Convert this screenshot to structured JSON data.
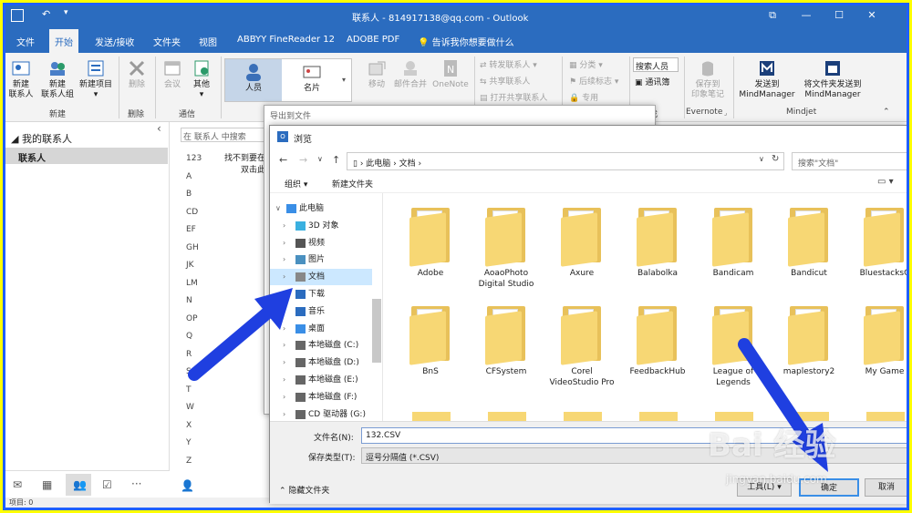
{
  "titlebar": {
    "title": "联系人 - 814917138@qq.com - Outlook",
    "restore": "⧉",
    "minimize": "—",
    "maximize": "☐",
    "close": "✕"
  },
  "tabs": [
    "文件",
    "开始",
    "发送/接收",
    "文件夹",
    "视图",
    "ABBYY FineReader 12",
    "ADOBE PDF",
    "告诉我你想要做什么"
  ],
  "active_tab": "开始",
  "ribbon": {
    "new_contact": "新建\n联系人",
    "new_group": "新建\n联系人组",
    "new_items": "新建项目",
    "group_new": "新建",
    "delete": "删除",
    "group_delete": "删除",
    "meeting": "会议",
    "other": "其他",
    "group_comm": "通信",
    "view_people": "人员",
    "view_card": "名片",
    "move": "移动",
    "mail_merge": "邮件合并",
    "onenote": "OneNote",
    "forward_contact": "转发联系人",
    "share_contact": "共享联系人",
    "open_shared": "打开共享联系人",
    "categorize": "分类",
    "followup": "后续标志",
    "private": "专用",
    "search_people": "搜索人员",
    "address_book": "通讯簿",
    "evernote_save": "保存到\n印象笔记",
    "group_evernote": "Evernote",
    "send_mindmanager": "发送到\nMindManager",
    "send_folder_mindmanager": "将文件夹发送到\nMindManager",
    "group_mindjet": "Mindjet",
    "group_find_partial": "找"
  },
  "leftpane": {
    "my_contacts": "我的联系人",
    "contacts": "联系人",
    "collapse": "‹"
  },
  "middle": {
    "search_placeholder": "在 联系人 中搜索",
    "empty_line1": "找不到要在",
    "empty_line2": "双击此",
    "alphabet": [
      "123",
      "A",
      "B",
      "CD",
      "EF",
      "GH",
      "JK",
      "LM",
      "N",
      "OP",
      "Q",
      "R",
      "S",
      "T",
      "W",
      "X",
      "Y",
      "Z"
    ]
  },
  "statusbar": {
    "items": "项目: 0"
  },
  "export_dialog": {
    "title": "导出到文件"
  },
  "browse": {
    "title": "浏览",
    "path": [
      "此电脑",
      "文档"
    ],
    "search_placeholder": "搜索\"文档\"",
    "organize": "组织 ▾",
    "new_folder": "新建文件夹",
    "tree": [
      {
        "label": "此电脑",
        "level": 0,
        "expanded": true
      },
      {
        "label": "3D 对象",
        "level": 1
      },
      {
        "label": "视频",
        "level": 1
      },
      {
        "label": "图片",
        "level": 1
      },
      {
        "label": "文档",
        "level": 1,
        "selected": true
      },
      {
        "label": "下载",
        "level": 1
      },
      {
        "label": "音乐",
        "level": 1
      },
      {
        "label": "桌面",
        "level": 1
      },
      {
        "label": "本地磁盘 (C:)",
        "level": 1
      },
      {
        "label": "本地磁盘 (D:)",
        "level": 1
      },
      {
        "label": "本地磁盘 (E:)",
        "level": 1
      },
      {
        "label": "本地磁盘 (F:)",
        "level": 1
      },
      {
        "label": "CD 驱动器 (G:)",
        "level": 1
      }
    ],
    "folders_row1": [
      "Adobe",
      "AoaoPhoto Digital Studio",
      "Axure",
      "Balabolka",
      "Bandicam",
      "Bandicut",
      "BluestacksC"
    ],
    "folders_row2": [
      "BnS",
      "CFSystem",
      "Corel VideoStudio Pro",
      "FeedbackHub",
      "League of Legends",
      "maplestory2",
      "My Game"
    ],
    "filename_label": "文件名(N):",
    "filename_value": "132.CSV",
    "filetype_label": "保存类型(T):",
    "filetype_value": "逗号分隔值 (*.CSV)",
    "hide_folders": "隐藏文件夹",
    "tools": "工具(L)",
    "ok": "确定",
    "cancel": "取消"
  },
  "watermark": {
    "text": "Bai 经验",
    "sub": "jingyan.baidu.com"
  },
  "colors": {
    "accent": "#2b6cbf",
    "frame": "#2060ff",
    "outer": "#ffff00",
    "arrow": "#1f3fe0",
    "folder": "#f7d774"
  }
}
